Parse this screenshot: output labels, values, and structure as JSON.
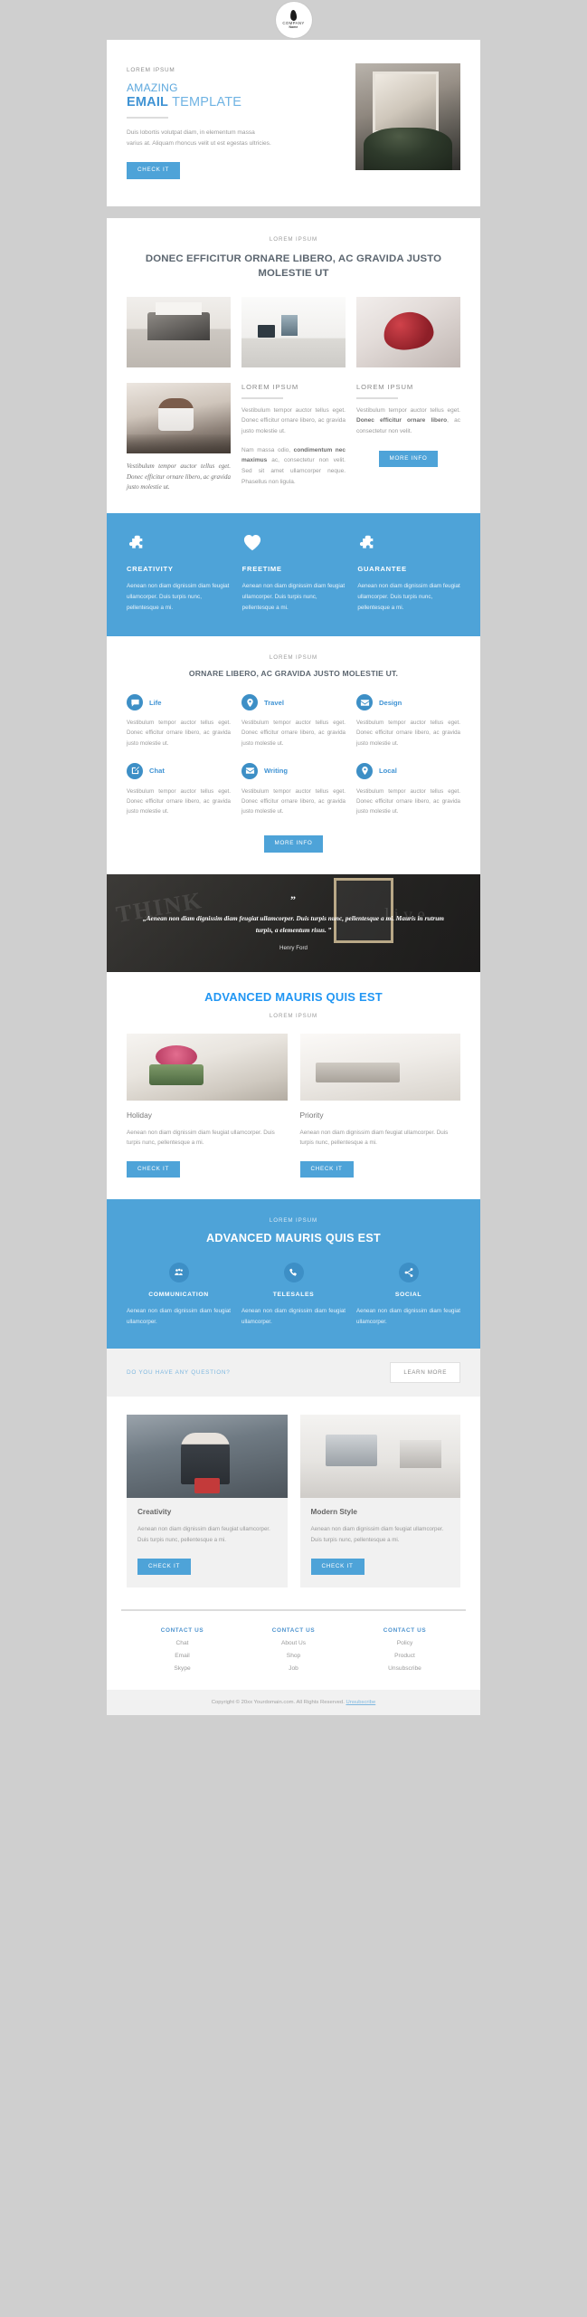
{
  "brand": {
    "accent": "#4ea3d8",
    "accent_dark": "#3d8fc6",
    "heading": "#5c6670",
    "bright_blue": "#2196f3"
  },
  "logo": {
    "line1": "COMPANY",
    "line2": "Name"
  },
  "hero": {
    "eyebrow": "LOREM IPSUM",
    "line1": "AMAZING",
    "line2_bold": "EMAIL",
    "line2_light": "TEMPLATE",
    "paragraph": "Duis lobortis volutpat diam, in elementum massa varius at. Aliquam rhoncus velit ut est egestas ultricies.",
    "button": "CHECK IT"
  },
  "section2": {
    "eyebrow": "LOREM IPSUM",
    "heading": "DONEC EFFICITUR ORNARE LIBERO, AC GRAVIDA JUSTO MOLESTIE UT",
    "serif_text": "Vestibulum tempor auctor tellus eget. Donec efficitur ornare libero, ac gravida justo molestie ut.",
    "col_mid": {
      "heading": "LOREM IPSUM",
      "p1": "Vestibulum tempor auctor tellus eget. Donec efficitur ornare libero, ac gravida justo molestie ut.",
      "p2_pre": "Nam massa odio, ",
      "p2_bold": "condimentum nec maximus",
      "p2_post": " ac, consectetur non velit. Sed sit amet ullamcorper neque. Phasellus non ligula."
    },
    "col_right": {
      "heading": "LOREM IPSUM",
      "p1_pre": "Vestibulum tempor auctor tellus eget. ",
      "p1_bold": "Donec efficitur ornare libero",
      "p1_post": ", ac consectetur non velit.",
      "button": "MORE INFO"
    }
  },
  "features": [
    {
      "icon": "puzzle-icon",
      "title": "CREATIVITY",
      "text": "Aenean non diam dignissim diam feugiat ullamcorper. Duis turpis nunc, pellentesque a mi."
    },
    {
      "icon": "heart-icon",
      "title": "FREETIME",
      "text": "Aenean non diam dignissim diam feugiat ullamcorper. Duis turpis nunc, pellentesque a mi."
    },
    {
      "icon": "puzzle-icon",
      "title": "GUARANTEE",
      "text": "Aenean non diam dignissim diam feugiat ullamcorper. Duis turpis nunc, pellentesque a mi."
    }
  ],
  "services": {
    "eyebrow": "LOREM IPSUM",
    "heading": "ORNARE LIBERO, AC GRAVIDA JUSTO MOLESTIE UT.",
    "items": [
      {
        "icon": "chat-bubble-icon",
        "name": "Life",
        "text": "Vestibulum tempor auctor tellus eget. Donec efficitur ornare libero, ac gravida justo molestie ut."
      },
      {
        "icon": "map-pin-icon",
        "name": "Travel",
        "text": "Vestibulum tempor auctor tellus eget. Donec efficitur ornare libero, ac gravida justo molestie ut."
      },
      {
        "icon": "envelope-icon",
        "name": "Design",
        "text": "Vestibulum tempor auctor tellus eget. Donec efficitur ornare libero, ac gravida justo molestie ut."
      },
      {
        "icon": "pencil-edit-icon",
        "name": "Chat",
        "text": "Vestibulum tempor auctor tellus eget. Donec efficitur ornare libero, ac gravida justo molestie ut."
      },
      {
        "icon": "envelope-icon",
        "name": "Writing",
        "text": "Vestibulum tempor auctor tellus eget. Donec efficitur ornare libero, ac gravida justo molestie ut."
      },
      {
        "icon": "map-pin-icon",
        "name": "Local",
        "text": "Vestibulum tempor auctor tellus eget. Donec efficitur ornare libero, ac gravida justo molestie ut."
      }
    ],
    "button": "MORE INFO"
  },
  "quote": {
    "mark": "”",
    "text": "„Aenean non diam dignissim diam feugiat ullamcorper. Duis turpis nunc, pellentesque a mi. Mauris in rutrum turpis, a elementum risus. ”",
    "author": "Henry Ford"
  },
  "advanced_white": {
    "heading": "ADVANCED MAURIS QUIS EST",
    "eyebrow": "LOREM IPSUM",
    "cards": [
      {
        "title": "Holiday",
        "text": "Aenean non diam dignissim diam feugiat ullamcorper. Duis turpis nunc, pellentesque a mi.",
        "button": "CHECK IT"
      },
      {
        "title": "Priority",
        "text": "Aenean non diam dignissim diam feugiat ullamcorper. Duis turpis nunc, pellentesque a mi.",
        "button": "CHECK IT"
      }
    ]
  },
  "advanced_blue": {
    "eyebrow": "LOREM IPSUM",
    "heading": "ADVANCED MAURIS QUIS EST",
    "items": [
      {
        "icon": "people-group-icon",
        "title": "COMMUNICATION",
        "text": "Aenean non diam dignissim diam feugiat ullamcorper."
      },
      {
        "icon": "phone-icon",
        "title": "TELESALES",
        "text": "Aenean non diam dignissim diam feugiat ullamcorper."
      },
      {
        "icon": "share-network-icon",
        "title": "SOCIAL",
        "text": "Aenean non diam dignissim diam feugiat ullamcorper."
      }
    ]
  },
  "cta": {
    "text": "DO YOU HAVE ANY QUESTION?",
    "button": "LEARN MORE"
  },
  "bottom_cards": [
    {
      "title": "Creativity",
      "text": "Aenean non diam dignissim diam feugiat ullamcorper. Duis turpis nunc, pellentesque a mi.",
      "button": "CHECK IT"
    },
    {
      "title": "Modern Style",
      "text": "Aenean non diam dignissim diam feugiat ullamcorper. Duis turpis nunc, pellentesque a mi.",
      "button": "CHECK IT"
    }
  ],
  "footer": {
    "columns": [
      {
        "heading": "CONTACT US",
        "links": [
          "Chat",
          "Email",
          "Skype"
        ]
      },
      {
        "heading": "CONTACT US",
        "links": [
          "About Us",
          "Shop",
          "Job"
        ]
      },
      {
        "heading": "CONTACT US",
        "links": [
          "Policy",
          "Product",
          "Unsubscribe"
        ]
      }
    ],
    "copyright_pre": "Copyright © 20xx Yourdomain.com. All Rights Reserved. ",
    "copyright_link": "Unsubscribe"
  }
}
